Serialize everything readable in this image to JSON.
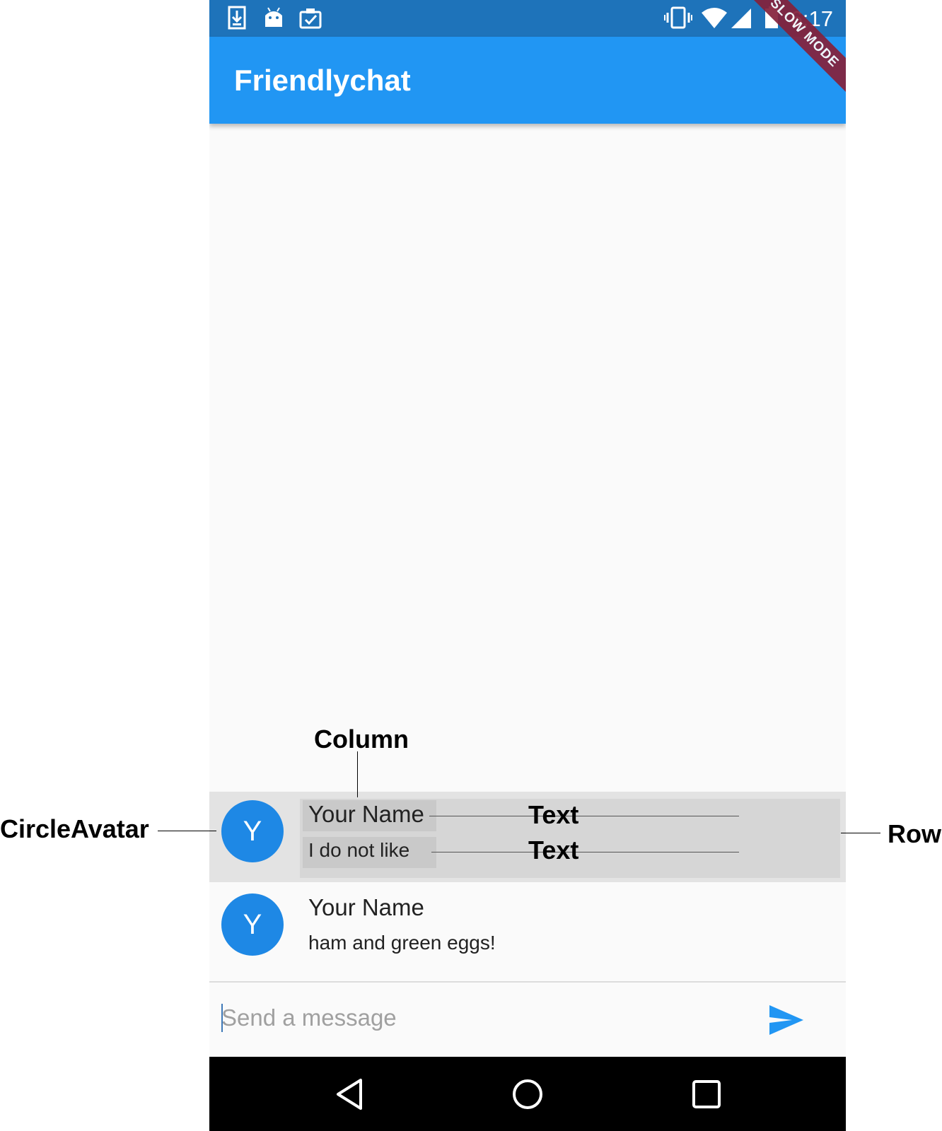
{
  "status_bar": {
    "time": "6:17",
    "left_icons": [
      "download-icon",
      "android-icon",
      "clipboard-check-icon"
    ],
    "right_icons": [
      "vibrate-icon",
      "wifi-icon",
      "cell-signal-icon",
      "battery-icon"
    ]
  },
  "debug_banner": "SLOW MODE",
  "app_bar": {
    "title": "Friendlychat"
  },
  "messages": [
    {
      "avatar_initial": "Y",
      "name": "Your Name",
      "text": "I do not like"
    },
    {
      "avatar_initial": "Y",
      "name": "Your Name",
      "text": "ham and green eggs!"
    }
  ],
  "composer": {
    "placeholder": "Send a message",
    "send_icon": "send-icon"
  },
  "nav_bar": {
    "icons": [
      "back-icon",
      "home-icon",
      "recents-icon"
    ]
  },
  "annotations": {
    "column": "Column",
    "circle_avatar": "CircleAvatar",
    "row": "Row",
    "text_name": "Text",
    "text_body": "Text"
  },
  "colors": {
    "status_bar": "#1e73ba",
    "app_bar": "#2196f3",
    "avatar": "#1e88e5",
    "banner": "#85213b"
  }
}
